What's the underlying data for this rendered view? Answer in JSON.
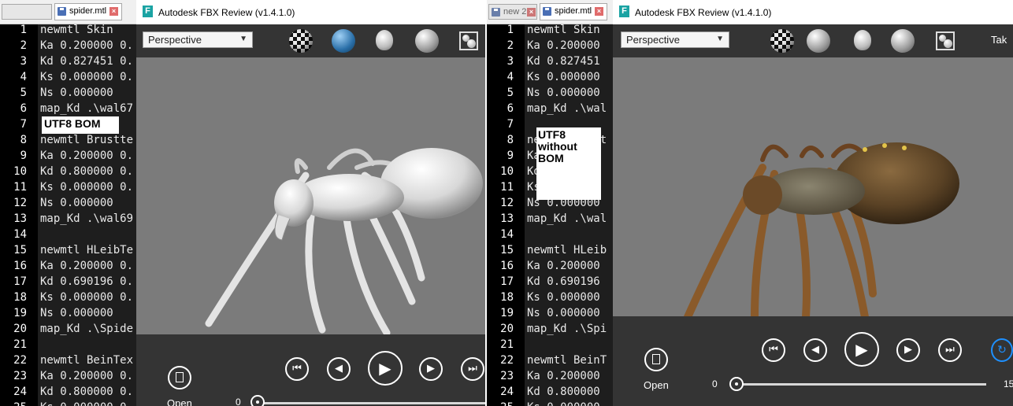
{
  "left_editor": {
    "tabs": [
      {
        "label": "",
        "active": false
      },
      {
        "label": "spider.mtl",
        "active": true
      }
    ],
    "line_numbers": [
      "1",
      "2",
      "3",
      "4",
      "5",
      "6",
      "7",
      "8",
      "9",
      "10",
      "11",
      "12",
      "13",
      "14",
      "15",
      "16",
      "17",
      "18",
      "19",
      "20",
      "21",
      "22",
      "23",
      "24",
      "25"
    ],
    "lines": [
      "newmtl Skin",
      "Ka 0.200000 0.",
      "Kd 0.827451 0.",
      "Ks 0.000000 0.",
      "Ns 0.000000",
      "map_Kd .\\wal67",
      "",
      "newmtl Brustte",
      "Ka 0.200000 0.",
      "Kd 0.800000 0.",
      "Ks 0.000000 0.",
      "Ns 0.000000",
      "map_Kd .\\wal69",
      "",
      "newmtl HLeibTe",
      "Ka 0.200000 0.",
      "Kd 0.690196 0.",
      "Ks 0.000000 0.",
      "Ns 0.000000",
      "map_Kd .\\Spide",
      "",
      "newmtl BeinTex",
      "Ka 0.200000 0.",
      "Kd 0.800000 0.",
      "Ks 0.000000 0."
    ],
    "annotation": "UTF8 BOM"
  },
  "left_viewer": {
    "title": "Autodesk FBX Review (v1.4.1.0)",
    "view_mode": "Perspective",
    "icons": [
      "checker-icon",
      "shaded-sphere-icon",
      "light-bulb-icon",
      "gray-sphere-icon",
      "fit-view-icon"
    ],
    "open_label": "Open",
    "time_start": "0"
  },
  "right_editor": {
    "tabs": [
      {
        "label": "new 2",
        "active": false
      },
      {
        "label": "spider.mtl",
        "active": true
      }
    ],
    "line_numbers": [
      "1",
      "2",
      "3",
      "4",
      "5",
      "6",
      "7",
      "8",
      "9",
      "10",
      "11",
      "12",
      "13",
      "14",
      "15",
      "16",
      "17",
      "18",
      "19",
      "20",
      "21",
      "22",
      "23",
      "24",
      "25"
    ],
    "lines": [
      "newmtl Skin",
      "Ka 0.200000",
      "Kd 0.827451",
      "Ks 0.000000",
      "Ns 0.000000",
      "map_Kd .\\wal",
      "",
      "newmtl Brust",
      "Ka 0.200000",
      "Kd 0.800000",
      "Ks 0.000000",
      "Ns 0.000000",
      "map_Kd .\\wal",
      "",
      "newmtl HLeib",
      "Ka 0.200000",
      "Kd 0.690196",
      "Ks 0.000000",
      "Ns 0.000000",
      "map_Kd .\\Spi",
      "",
      "newmtl BeinT",
      "Ka 0.200000",
      "Kd 0.800000",
      "Ks 0.000000"
    ],
    "annotation": "UTF8 without BOM"
  },
  "right_viewer": {
    "title": "Autodesk FBX Review (v1.4.1.0)",
    "view_mode": "Perspective",
    "icons": [
      "checker-icon",
      "gray-sphere-icon",
      "light-bulb-icon",
      "gray-sphere-icon",
      "fit-view-icon"
    ],
    "toolbar_right_label": "Tak",
    "open_label": "Open",
    "time_start": "0",
    "time_end": "15"
  },
  "colors": {
    "editor_bg": "#1e1e1e",
    "viewer_toolbar": "#343434",
    "viewport_bg": "#7b7b7b",
    "accent_blue": "#1e90ff"
  }
}
